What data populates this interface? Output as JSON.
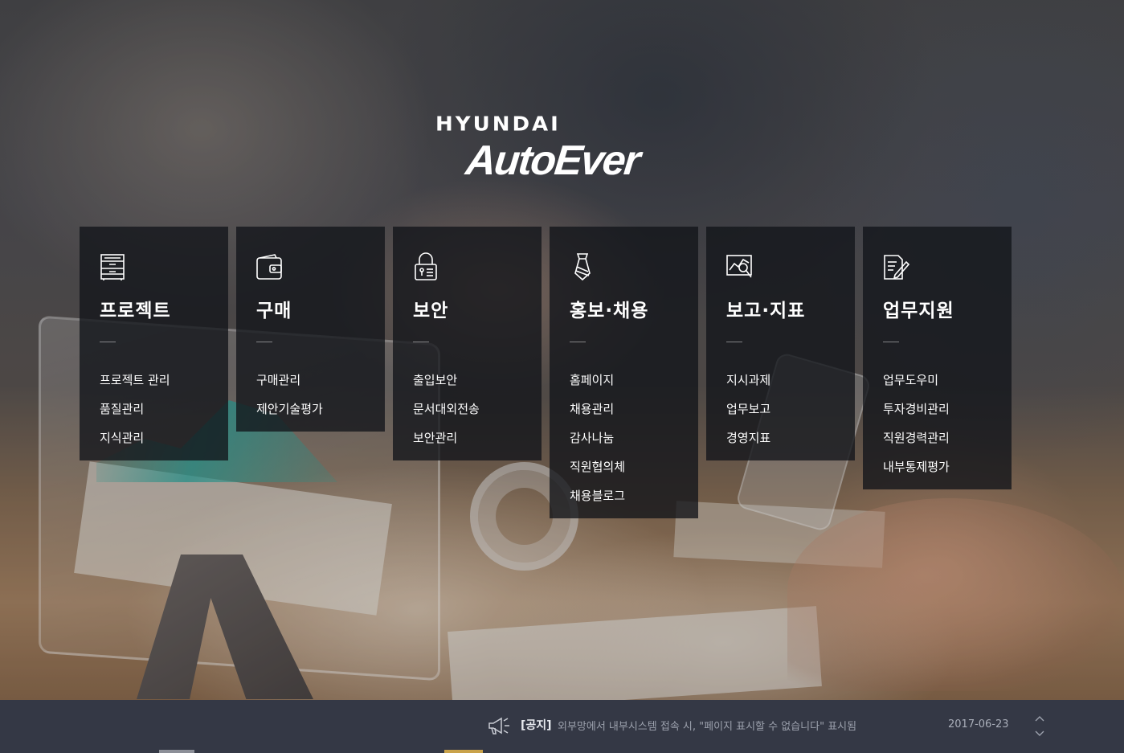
{
  "logo": {
    "line1": "HYUNDAI",
    "line2": "AutoEver"
  },
  "menu": [
    {
      "title": "프로젝트",
      "icon": "cabinet-icon",
      "items": [
        "프로젝트 관리",
        "품질관리",
        "지식관리"
      ]
    },
    {
      "title": "구매",
      "icon": "wallet-icon",
      "items": [
        "구매관리",
        "제안기술평가"
      ]
    },
    {
      "title": "보안",
      "icon": "lock-icon",
      "items": [
        "출입보안",
        "문서대외전송",
        "보안관리"
      ]
    },
    {
      "title": "홍보·채용",
      "icon": "necktie-icon",
      "items": [
        "홈페이지",
        "채용관리",
        "감사나눔",
        "직원협의체",
        "채용블로그"
      ]
    },
    {
      "title": "보고·지표",
      "icon": "chart-magnifier-icon",
      "items": [
        "지시과제",
        "업무보고",
        "경영지표"
      ]
    },
    {
      "title": "업무지원",
      "icon": "document-pen-icon",
      "items": [
        "업무도우미",
        "투자경비관리",
        "직원경력관리",
        "내부통제평가"
      ]
    }
  ],
  "notice": {
    "icon": "megaphone-icon",
    "tag": "[공지]",
    "message": "외부망에서 내부시스템 접속 시, \"페이지 표시할 수 없습니다\" 표시됨",
    "date": "2017-06-23"
  },
  "colors": {
    "panel_bg": "#14161ccc",
    "notice_bg": "#343845",
    "notice_text": "#9ca1ad",
    "accent_line": "#c9a24a"
  }
}
